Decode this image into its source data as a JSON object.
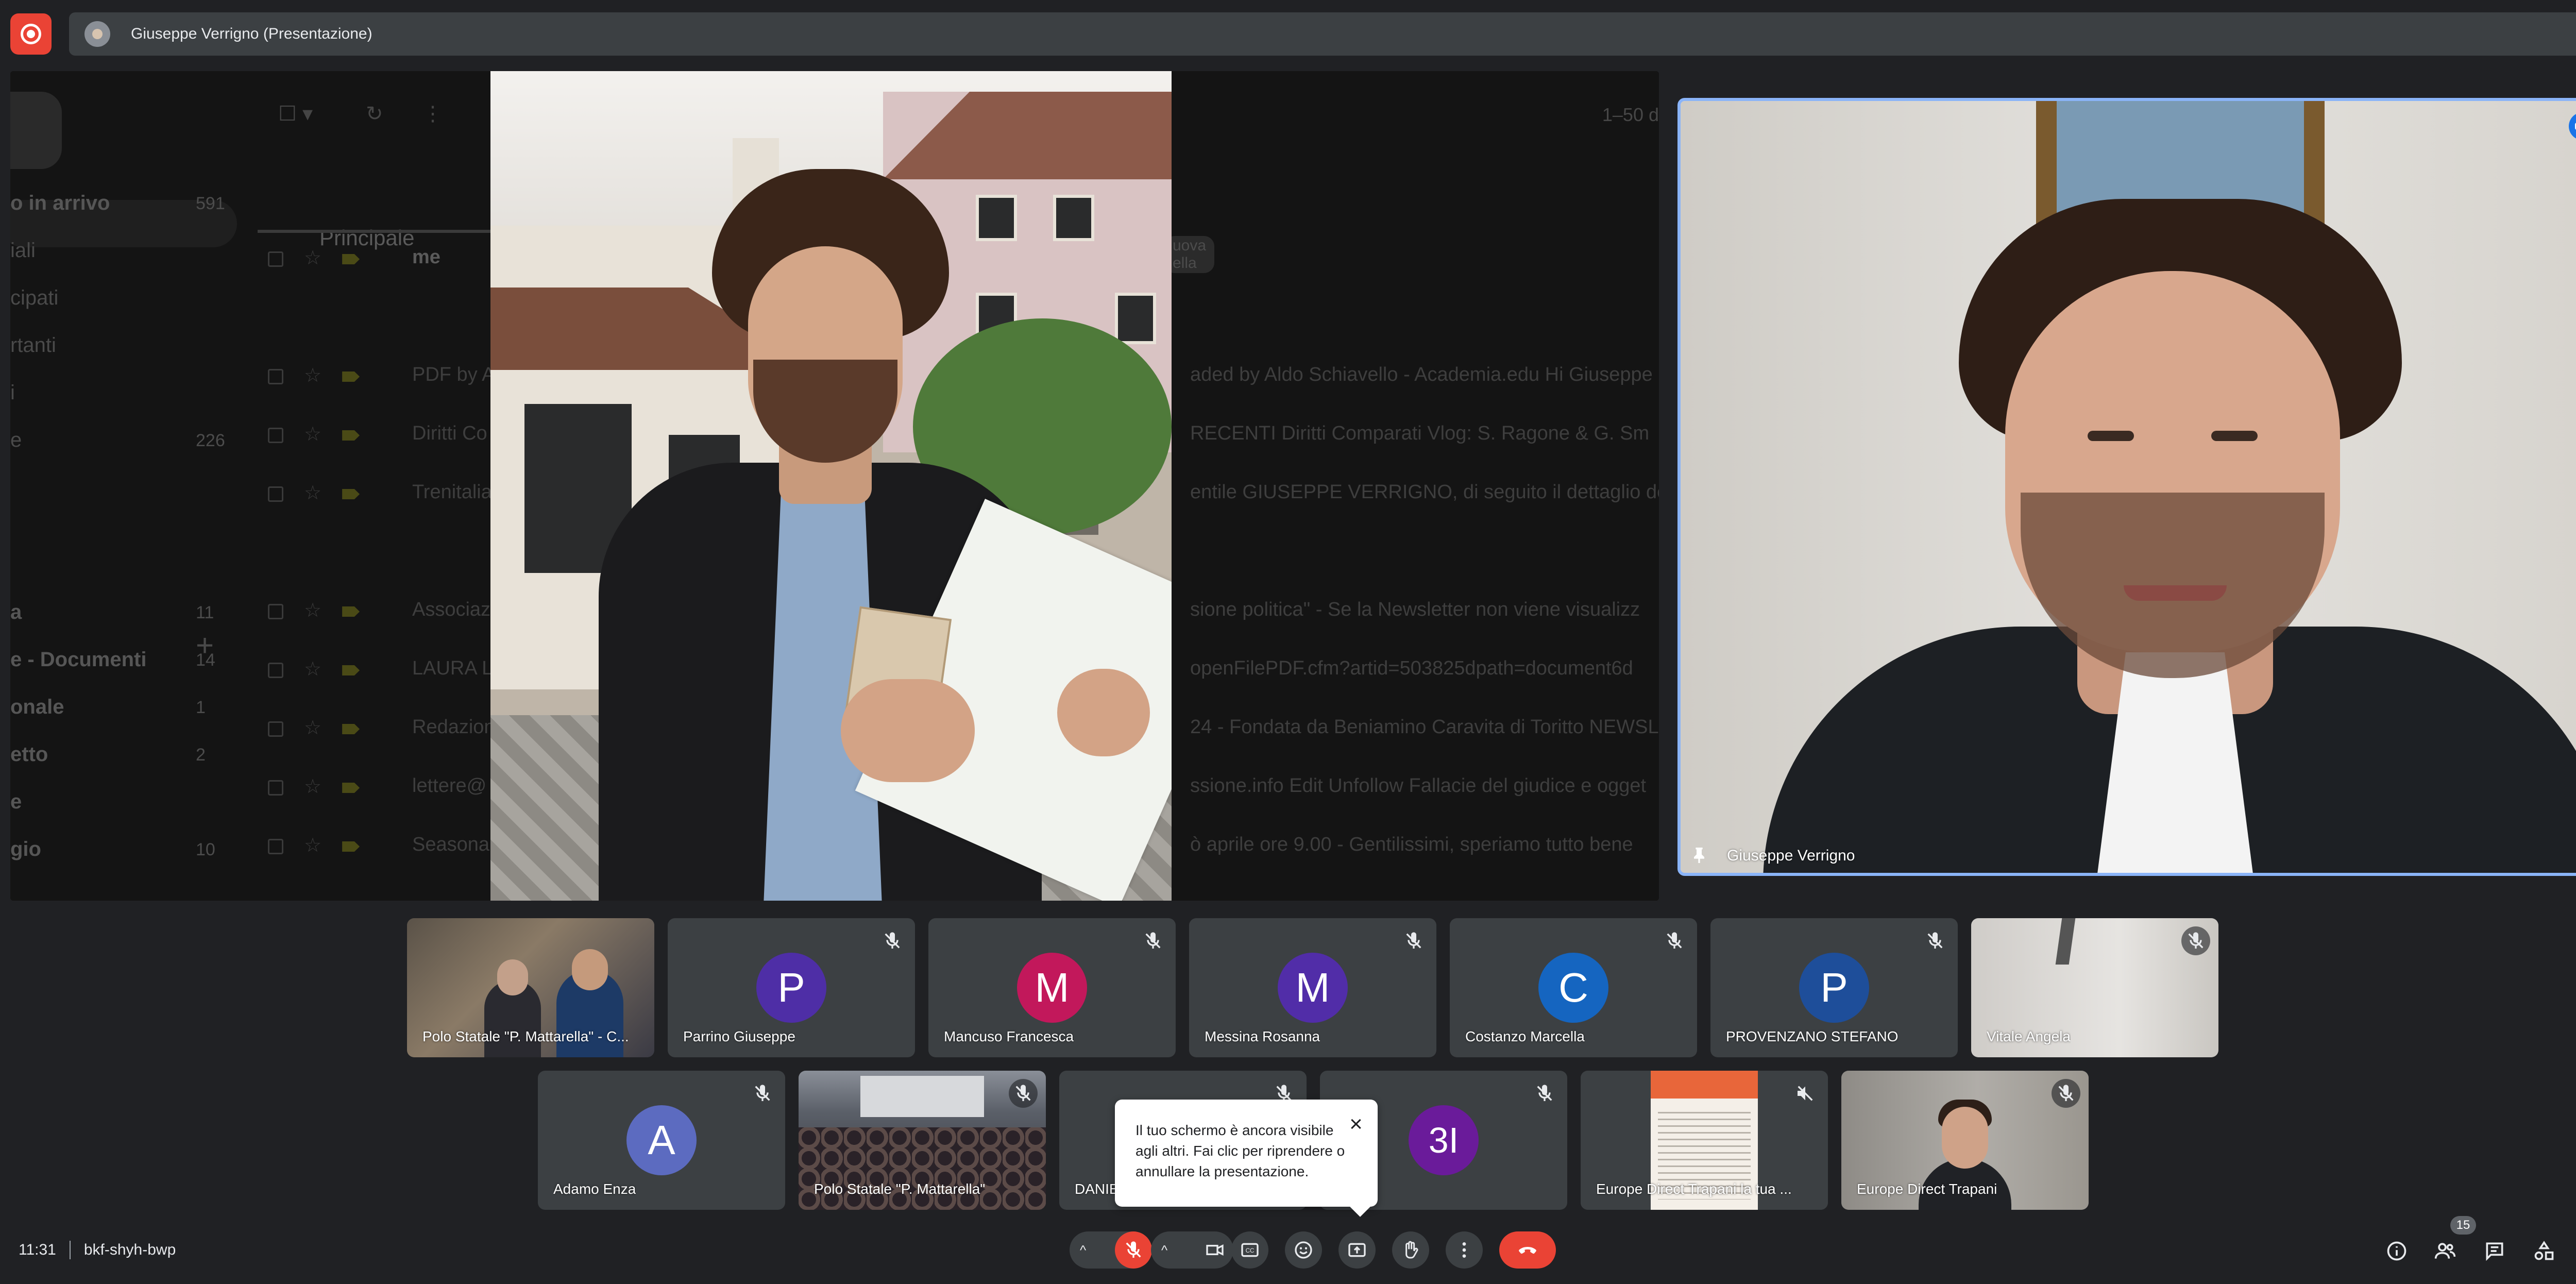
{
  "top_bar": {
    "presenter_title": "Giuseppe Verrigno (Presentazione)"
  },
  "gmail_background": {
    "folders": [
      {
        "label": "o in arrivo",
        "count": "591"
      },
      {
        "label": "iali",
        "count": ""
      },
      {
        "label": "cipati",
        "count": ""
      },
      {
        "label": "rtanti",
        "count": ""
      },
      {
        "label": "i",
        "count": ""
      },
      {
        "label": "e",
        "count": "226"
      },
      {
        "label": "a",
        "count": "11"
      },
      {
        "label": "e - Documenti",
        "count": "14"
      },
      {
        "label": "onale",
        "count": "1"
      },
      {
        "label": "etto",
        "count": "2"
      },
      {
        "label": "e",
        "count": ""
      },
      {
        "label": "gio",
        "count": "10"
      }
    ],
    "tab": "Principale",
    "page_count": "1–50 d",
    "badge": "uova",
    "badge_sub": "ella",
    "rows": [
      {
        "sender": "me",
        "snippet": ""
      },
      {
        "sender": "PDF by A",
        "snippet": "aded by Aldo Schiavello - Academia.edu Hi Giuseppe"
      },
      {
        "sender": "Diritti Co",
        "snippet": "RECENTI Diritti Comparati Vlog: S. Ragone & G. Sm"
      },
      {
        "sender": "Trenitalia",
        "snippet": "entile GIUSEPPE VERRIGNO, di seguito il dettaglio del"
      },
      {
        "sender": "Associaz",
        "snippet": "sione politica\" - Se la Newsletter non viene visualizz"
      },
      {
        "sender": "LAURA L",
        "snippet": "openFilePDF.cfm?artid=503825dpath=document6d"
      },
      {
        "sender": "Redazion",
        "snippet": "24 - Fondata da Beniamino Caravita di Toritto NEWSL"
      },
      {
        "sender": "lettere@",
        "snippet": "ssione.info Edit Unfollow Fallacie del giudice e ogget"
      },
      {
        "sender": "Seasonal",
        "snippet": "ò aprile ore 9.00 - Gentilissimi, speriamo tutto bene"
      }
    ]
  },
  "pinned_tile": {
    "name": "Giuseppe Verrigno"
  },
  "participants_row1": [
    {
      "name": "Polo Statale \"P. Mattarella\" - C...",
      "kind": "video-meeting"
    },
    {
      "name": "Parrino Giuseppe",
      "initial": "P",
      "color": "#4e2ea6"
    },
    {
      "name": "Mancuso Francesca",
      "initial": "M",
      "color": "#c2185b"
    },
    {
      "name": "Messina Rosanna",
      "initial": "M",
      "color": "#512da8"
    },
    {
      "name": "Costanzo Marcella",
      "initial": "C",
      "color": "#1565c0"
    },
    {
      "name": "PROVENZANO STEFANO",
      "initial": "P",
      "color": "#1e4e9a"
    },
    {
      "name": "Vitale Angela",
      "kind": "video-wall"
    }
  ],
  "participants_row2": [
    {
      "name": "Adamo Enza",
      "initial": "A",
      "color": "#5c6bc0"
    },
    {
      "name": "Polo Statale \"P. Mattarella\"",
      "kind": "video-hall"
    },
    {
      "name": "DANIE",
      "kind": "blank"
    },
    {
      "name": "",
      "initial": "3I",
      "color": "#6a1b9a"
    },
    {
      "name": "Europe Direct Trapani la tua ...",
      "kind": "video-poster"
    },
    {
      "name": "Europe Direct Trapani",
      "kind": "video-room"
    }
  ],
  "toast": {
    "message": "Il tuo schermo è ancora visibile agli altri. Fai clic per riprendere o annullare la presentazione."
  },
  "bottom_bar": {
    "time": "11:31",
    "meeting_code": "bkf-shyh-bwp",
    "people_count": "15"
  },
  "colors": {
    "background": "#202124",
    "tile": "#3c4043",
    "danger": "#ea4335",
    "accent": "#8ab4f8",
    "speaking": "#1a73e8"
  },
  "icons": {
    "record": "record-icon",
    "mic_off": "mic-off-icon",
    "camera": "camera-icon",
    "captions": "captions-icon",
    "emoji": "emoji-icon",
    "present": "present-screen-icon",
    "raise_hand": "raise-hand-icon",
    "more": "more-options-icon",
    "end_call": "end-call-icon",
    "info": "info-icon",
    "people": "people-icon",
    "chat": "chat-icon",
    "activities": "activities-icon",
    "host_controls": "host-controls-icon"
  }
}
